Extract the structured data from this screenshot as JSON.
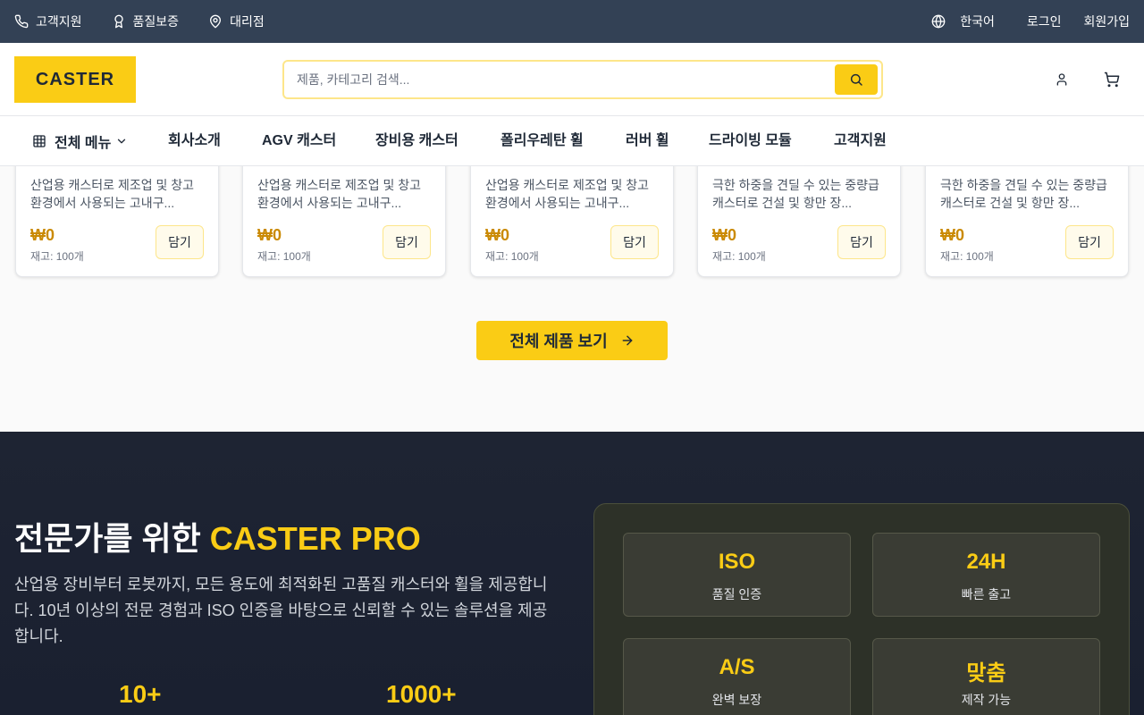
{
  "topbar": {
    "support": "고객지원",
    "quality": "품질보증",
    "dealer": "대리점",
    "language": "한국어",
    "login": "로그인",
    "signup": "회원가입"
  },
  "header": {
    "logo": "CASTER",
    "search_placeholder": "제품, 카테고리 검색..."
  },
  "nav": {
    "all_menu": "전체 메뉴",
    "items": [
      "회사소개",
      "AGV 캐스터",
      "장비용 캐스터",
      "폴리우레탄 휠",
      "러버 휠",
      "드라이빙 모듈",
      "고객지원"
    ]
  },
  "products": [
    {
      "desc": "산업용 캐스터로 제조업 및 창고 환경에서 사용되는 고내구...",
      "price": "₩0",
      "stock": "재고: 100개",
      "cart": "담기"
    },
    {
      "desc": "산업용 캐스터로 제조업 및 창고 환경에서 사용되는 고내구...",
      "price": "₩0",
      "stock": "재고: 100개",
      "cart": "담기"
    },
    {
      "desc": "산업용 캐스터로 제조업 및 창고 환경에서 사용되는 고내구...",
      "price": "₩0",
      "stock": "재고: 100개",
      "cart": "담기"
    },
    {
      "desc": "극한 하중을 견딜 수 있는 중량급 캐스터로 건설 및 항만 장...",
      "price": "₩0",
      "stock": "재고: 100개",
      "cart": "담기"
    },
    {
      "desc": "극한 하중을 견딜 수 있는 중량급 캐스터로 건설 및 항만 장...",
      "price": "₩0",
      "stock": "재고: 100개",
      "cart": "담기"
    }
  ],
  "view_all": "전체 제품 보기",
  "pro": {
    "title_prefix": "전문가를 위한 ",
    "title_highlight": "CASTER PRO",
    "description": "산업용 장비부터 로봇까지, 모든 용도에 최적화된 고품질 캐스터와 휠을 제공합니다. 10년 이상의 전문 경험과 ISO 인증을 바탕으로 신뢰할 수 있는 솔루션을 제공합니다.",
    "stats": [
      "10+",
      "1000+"
    ],
    "features": [
      {
        "title": "ISO",
        "sub": "품질 인증"
      },
      {
        "title": "24H",
        "sub": "빠른 출고"
      },
      {
        "title": "A/S",
        "sub": "완벽 보장"
      },
      {
        "title": "맞춤",
        "sub": "제작 가능"
      }
    ]
  },
  "colors": {
    "accent": "#facc15",
    "topbar": "#334155",
    "dark": "#1e2433"
  }
}
